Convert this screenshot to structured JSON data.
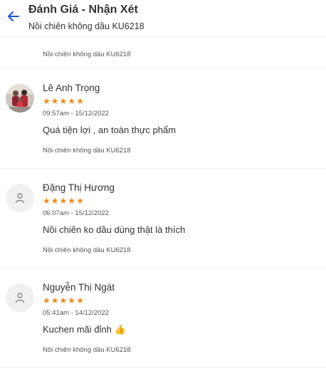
{
  "header": {
    "title": "Đánh Giá - Nhận Xét",
    "subtitle": "Nồi chiên không dầu KU6218"
  },
  "partial_review": {
    "product": "Nồi chiên không dầu KU6218"
  },
  "reviews": [
    {
      "name": "Lê Anh Trọng",
      "avatar": "photo-avatar",
      "rating": 5,
      "time": "09:57am - 15/12/2022",
      "comment": "Quá tiện lợi , an toàn thực phẩm",
      "product": "Nồi chiên không dầu KU6218"
    },
    {
      "name": "Đặng Thị Hương",
      "avatar": "user-placeholder-icon",
      "rating": 5,
      "time": "06:07am - 15/12/2022",
      "comment": "Nồi chiên ko dầu dùng thật là thích",
      "product": "Nồi chiên không dầu KU6218"
    },
    {
      "name": "Nguyễn Thị Ngát",
      "avatar": "user-placeholder-icon",
      "rating": 5,
      "time": "05:41am - 14/12/2022",
      "comment": "Kuchen mãi đỉnh 👍",
      "product": "Nồi chiên không dầu KU6218"
    }
  ],
  "colors": {
    "accent": "#1a56db",
    "star": "#f08a16",
    "avatar_bg": "#f0f0f0"
  }
}
